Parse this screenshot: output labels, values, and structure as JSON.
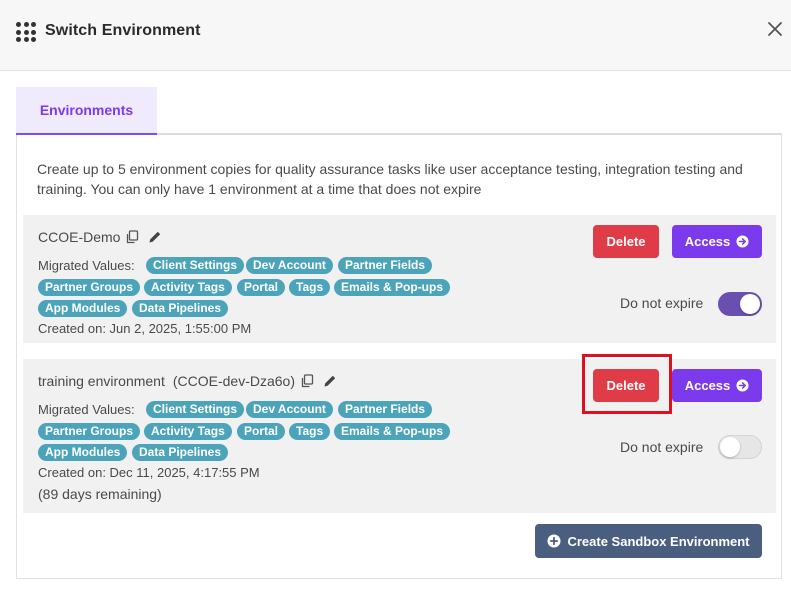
{
  "dialog": {
    "title": "Switch Environment"
  },
  "tabs": [
    {
      "label": "Environments",
      "active": true
    }
  ],
  "description": "Create up to 5 environment copies for quality assurance tasks like user acceptance testing, integration testing and training. You can only have 1 environment at a time that does not expire",
  "environments": [
    {
      "name": "CCOE-Demo",
      "subtitle": "",
      "migrated_label": "Migrated Values:",
      "tags": [
        "Client Settings",
        "Dev Account",
        "Partner Fields",
        "Partner Groups",
        "Activity Tags",
        "Portal",
        "Tags",
        "Emails & Pop-ups",
        "App Modules",
        "Data Pipelines"
      ],
      "created": "Created on: Jun 2, 2025, 1:55:00 PM",
      "remaining": "",
      "delete_label": "Delete",
      "access_label": "Access",
      "expire_label": "Do not expire",
      "do_not_expire": true
    },
    {
      "name": "training environment",
      "subtitle": "(CCOE-dev-Dza6o)",
      "migrated_label": "Migrated Values:",
      "tags": [
        "Client Settings",
        "Dev Account",
        "Partner Fields",
        "Partner Groups",
        "Activity Tags",
        "Portal",
        "Tags",
        "Emails & Pop-ups",
        "App Modules",
        "Data Pipelines"
      ],
      "created": "Created on: Dec 11, 2025, 4:17:55 PM",
      "remaining": "(89 days remaining)",
      "delete_label": "Delete",
      "access_label": "Access",
      "expire_label": "Do not expire",
      "do_not_expire": false
    }
  ],
  "create_button_label": "Create Sandbox Environment",
  "colors": {
    "accent": "#7c3aed",
    "delete": "#e03c47",
    "tag": "#4ba4ba",
    "create": "#4a5e80",
    "highlight": "#e0101e"
  },
  "icons": [
    "apps-grid-icon",
    "close-icon",
    "copy-icon",
    "pencil-icon",
    "arrow-right-circle-icon",
    "plus-circle-icon"
  ]
}
